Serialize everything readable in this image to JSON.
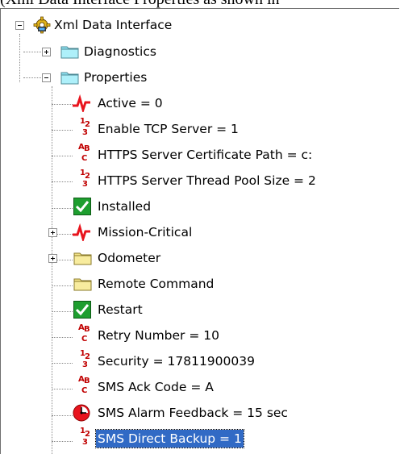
{
  "caption": "(Xml Data Interface Properties as shown in",
  "tree": {
    "root": "Xml Data Interface",
    "diagnostics": "Diagnostics",
    "properties": "Properties",
    "items": [
      "Active = 0",
      "Enable TCP Server = 1",
      "HTTPS Server Certificate Path = c:",
      "HTTPS Server Thread Pool Size = 2",
      "Installed",
      "Mission-Critical",
      "Odometer",
      "Remote Command",
      "Restart",
      "Retry Number =  10",
      "Security = 17811900039",
      "SMS Ack Code = A",
      "SMS Alarm Feedback = 15 sec",
      "SMS Direct Backup = 1"
    ]
  },
  "colors": {
    "selection": "#316ac5",
    "red_glyph": "#c00000",
    "check_green": "#1e9e2f",
    "folder_yellow": "#f4e48a",
    "folder_cyan": "#8fe3f2"
  }
}
